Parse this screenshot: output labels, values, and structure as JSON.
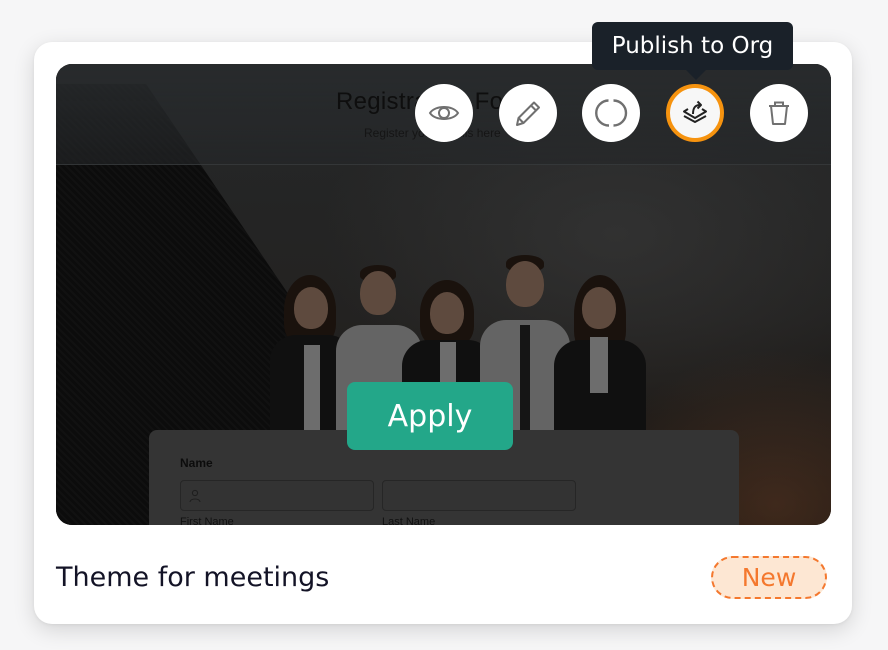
{
  "theme_card": {
    "title": "Theme for meetings",
    "badge": "New",
    "apply_label": "Apply",
    "tooltip": "Publish to Org",
    "actions": [
      {
        "name": "preview",
        "icon": "eye-icon"
      },
      {
        "name": "edit",
        "icon": "pencil-icon"
      },
      {
        "name": "clone",
        "icon": "refresh-circle-icon"
      },
      {
        "name": "publish-to-org",
        "icon": "layers-share-icon",
        "active": true
      },
      {
        "name": "delete",
        "icon": "trash-icon"
      }
    ],
    "preview": {
      "form_title": "Registration Form",
      "form_subtitle": "Register your details here",
      "field_label": "Name",
      "first_name_label": "First Name",
      "last_name_label": "Last Name"
    }
  },
  "colors": {
    "apply_green": "#23a789",
    "active_ring_orange": "#f6930f",
    "badge_orange": "#f4782e",
    "badge_bg": "#fde7d3",
    "tooltip_bg": "#1a2129",
    "title_text": "#131326"
  }
}
